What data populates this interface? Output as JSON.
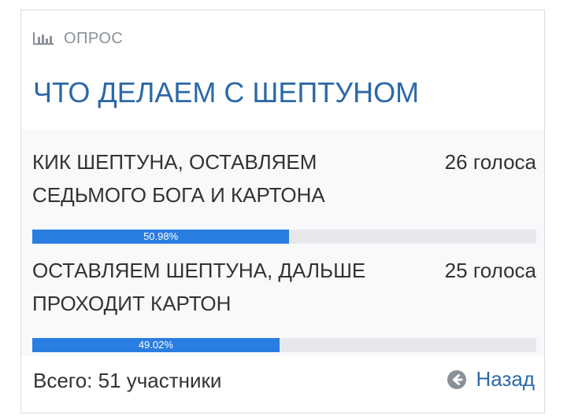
{
  "poll": {
    "header_label": "ОПРОС",
    "header_icon": "bar-chart-icon",
    "title": "ЧТО ДЕЛАЕМ С ШЕПТУНОМ",
    "options": [
      {
        "text": "КИК ШЕПТУНА, ОСТАВЛЯЕМ СЕДЬМОГО БОГА И КАРТОНА",
        "votes": "26 голоса",
        "percent_label": "50.98%",
        "percent": 50.98
      },
      {
        "text": "ОСТАВЛЯЕМ ШЕПТУНА, ДАЛЬШЕ ПРОХОДИТ КАРТОН",
        "votes": "25 голоса",
        "percent_label": "49.02%",
        "percent": 49.02
      }
    ],
    "total": "Всего: 51 участники",
    "back_label": "Назад",
    "back_icon": "arrow-left-circle-icon"
  },
  "colors": {
    "accent": "#2c69a6",
    "bar_fill": "#2a7de1",
    "bar_track": "#e6e8ec",
    "muted": "#8a9099",
    "text": "#333333"
  }
}
